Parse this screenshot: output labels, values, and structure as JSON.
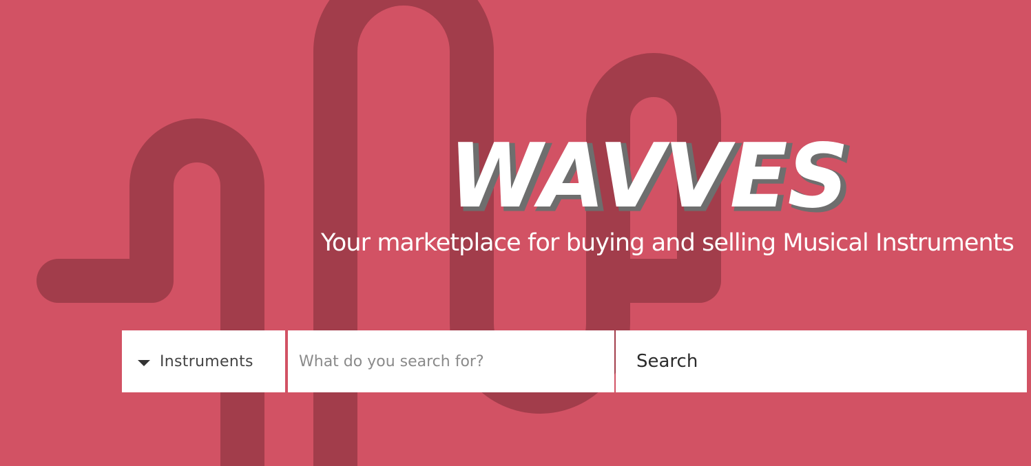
{
  "brand": {
    "logo_text": "WAVVES",
    "tagline": "Your marketplace for buying and selling Musical Instruments"
  },
  "search": {
    "category_selected": "Instruments",
    "placeholder": "What do you search for?",
    "value": "",
    "button_label": "Search"
  },
  "colors": {
    "background": "#d25264",
    "wave": "#a23d4b",
    "surface": "#ffffff"
  },
  "icons": {
    "category_caret": "caret-down-icon"
  }
}
